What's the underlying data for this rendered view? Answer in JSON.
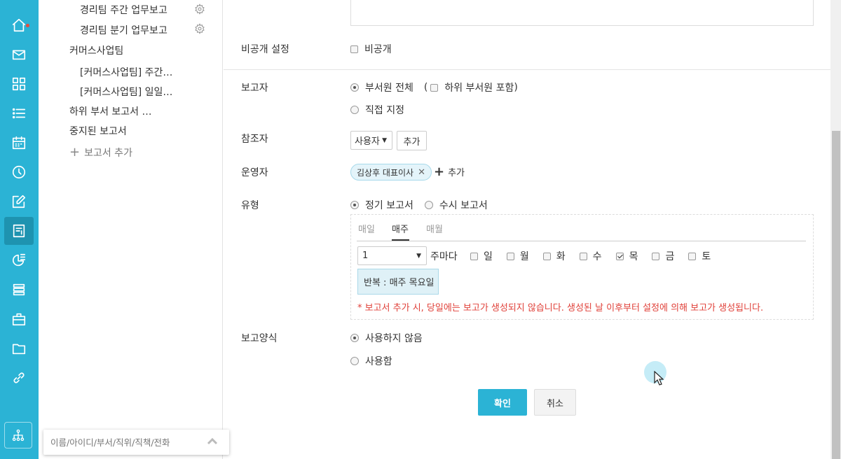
{
  "rail": {
    "icons": [
      "home-icon",
      "mail-icon",
      "grid-icon",
      "list-icon",
      "calendar-icon",
      "clock-icon",
      "edit-icon",
      "report-icon",
      "chart-icon",
      "stack-icon",
      "briefcase-icon",
      "folder-icon",
      "link-icon"
    ],
    "active": "report-icon",
    "bottom_icon": "org-chart-icon"
  },
  "tree": {
    "items": [
      {
        "label": "경리팀 주간 업무보고",
        "has_gear": true
      },
      {
        "label": "경리팀 분기 업무보고",
        "has_gear": true
      },
      {
        "label": "커머스사업팀",
        "has_gear": false
      },
      {
        "label": "[커머스사업팀] 주간…",
        "has_gear": false
      },
      {
        "label": "[커머스사업팀] 일일…",
        "has_gear": false
      },
      {
        "label": "하위 부서 보고서 …",
        "has_gear": false
      },
      {
        "label": "중지된 보고서",
        "has_gear": false
      }
    ],
    "add_report": "보고서 추가"
  },
  "search": {
    "placeholder": "이름/아이디/부서/직위/직책/전화"
  },
  "form": {
    "private": {
      "label": "비공개 설정",
      "option": "비공개",
      "checked": false
    },
    "reporter": {
      "label": "보고자",
      "all_members": "부서원 전체",
      "include_sub_open": "(",
      "include_sub": "하위 부서원 포함",
      "include_sub_close": ")",
      "direct": "직접 지정",
      "selected": "all_members"
    },
    "referrer": {
      "label": "참조자",
      "select_value": "사용자",
      "add_button": "추가"
    },
    "operator": {
      "label": "운영자",
      "chip": "김상후 대표이사",
      "add": "추가"
    },
    "type": {
      "label": "유형",
      "regular": "정기 보고서",
      "adhoc": "수시 보고서",
      "selected": "regular",
      "tabs": [
        "매일",
        "매주",
        "매월"
      ],
      "active_tab": "매주",
      "week_value": "1",
      "every_week_text": "주마다",
      "days": [
        {
          "label": "일",
          "checked": false
        },
        {
          "label": "월",
          "checked": false
        },
        {
          "label": "화",
          "checked": false
        },
        {
          "label": "수",
          "checked": false
        },
        {
          "label": "목",
          "checked": true
        },
        {
          "label": "금",
          "checked": false
        },
        {
          "label": "토",
          "checked": false
        }
      ],
      "repeat": "반복 : 매주 목요일",
      "warning": "* 보고서 추가 시, 당일에는 보고가 생성되지 않습니다. 생성된 날 이후부터 설정에 의해 보고가 생성됩니다."
    },
    "template": {
      "label": "보고양식",
      "not_used": "사용하지 않음",
      "used": "사용함",
      "selected": "not_used"
    },
    "ok_button": "확인",
    "cancel_button": "취소"
  },
  "colors": {
    "accent": "#2bb3d5",
    "warning": "#e0413a"
  }
}
